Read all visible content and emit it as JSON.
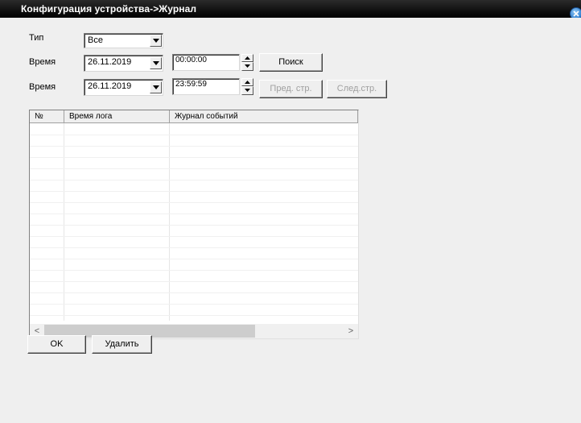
{
  "window": {
    "title": "Конфигурация устройства->Журнал"
  },
  "filters": {
    "type_label": "Тип",
    "type_value": "Все",
    "start_label": "Время",
    "start_date": "26.11.2019",
    "start_time": "00:00:00",
    "end_label": "Время",
    "end_date": "26.11.2019",
    "end_time": "23:59:59"
  },
  "buttons": {
    "search": "Поиск",
    "prev_page": "Пред. стр.",
    "next_page": "След.стр.",
    "ok": "OK",
    "delete": "Удалить"
  },
  "table": {
    "columns": [
      "№",
      "Время лога",
      "Журнал событий"
    ],
    "rows": []
  },
  "colors": {
    "titlebar": "#000000",
    "panel_bg": "#efefef",
    "close_icon": "#2f7ed0"
  },
  "icons": {
    "close": "close-icon",
    "dropdown": "chevron-down-icon",
    "spin_up": "spin-up-icon",
    "spin_down": "spin-down-icon"
  }
}
